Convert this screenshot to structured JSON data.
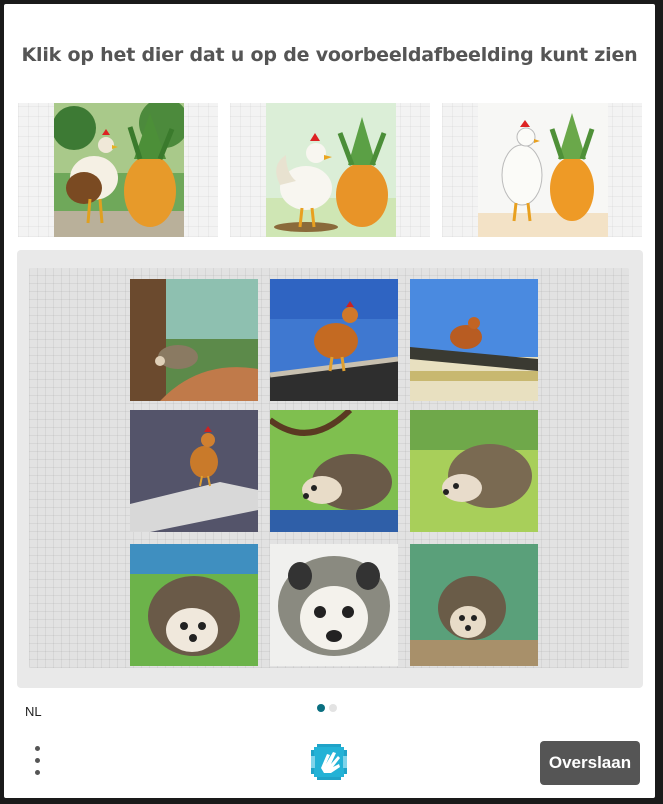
{
  "prompt": "Klik op het dier dat u op de voorbeeldafbeelding kunt zien",
  "examples": [
    {
      "label": "rooster-and-pineapple-park"
    },
    {
      "label": "rooster-and-pineapple-cartoon"
    },
    {
      "label": "chicken-and-pineapple-sketch"
    }
  ],
  "grid": [
    {
      "subject": "hedgehog"
    },
    {
      "subject": "chicken"
    },
    {
      "subject": "chicken"
    },
    {
      "subject": "chicken"
    },
    {
      "subject": "hedgehog"
    },
    {
      "subject": "hedgehog"
    },
    {
      "subject": "hedgehog"
    },
    {
      "subject": "hedgehog"
    },
    {
      "subject": "hedgehog"
    }
  ],
  "footer": {
    "language": "NL",
    "pagination": {
      "total": 2,
      "current": 1
    },
    "skip_label": "Overslaan",
    "logo_icon": "hand-logo-icon",
    "menu_icon": "vertical-dots-icon"
  },
  "colors": {
    "accent": "#0a6f80",
    "button": "#555555",
    "prompt_text": "#555555"
  }
}
